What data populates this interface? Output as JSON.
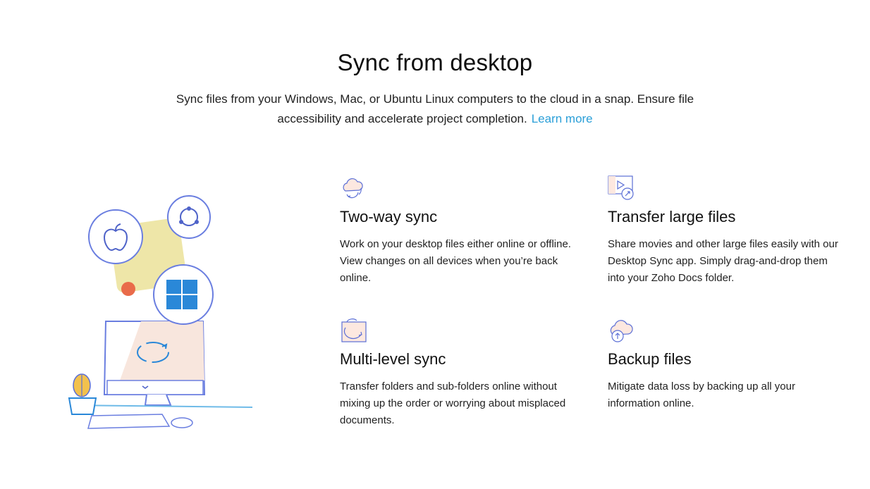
{
  "header": {
    "title": "Sync from desktop",
    "description": "Sync files from your Windows, Mac, or Ubuntu Linux computers to the cloud in a snap. Ensure file accessibility and accelerate project completion.",
    "learn_more": "Learn more"
  },
  "colors": {
    "accent": "#2a9fd8",
    "icon_stroke": "#5b6fd6",
    "illustration_yellow": "#eee6a8",
    "illustration_orange": "#e96b4a",
    "windows_blue": "#2a88d8"
  },
  "features": [
    {
      "icon": "cloud-sync-icon",
      "title": "Two-way sync",
      "text": "Work on your desktop files either online or offline. View changes on all devices when you’re back online."
    },
    {
      "icon": "video-transfer-icon",
      "title": "Transfer large files",
      "text": "Share movies and other large files easily with our Desktop Sync app. Simply drag-and-drop them into your Zoho Docs folder."
    },
    {
      "icon": "folder-sync-icon",
      "title": "Multi-level sync",
      "text": "Transfer folders and sub-folders online without mixing up the order or worrying about misplaced documents."
    },
    {
      "icon": "cloud-upload-icon",
      "title": "Backup files",
      "text": "Mitigate data loss by backing up all your information online."
    }
  ]
}
